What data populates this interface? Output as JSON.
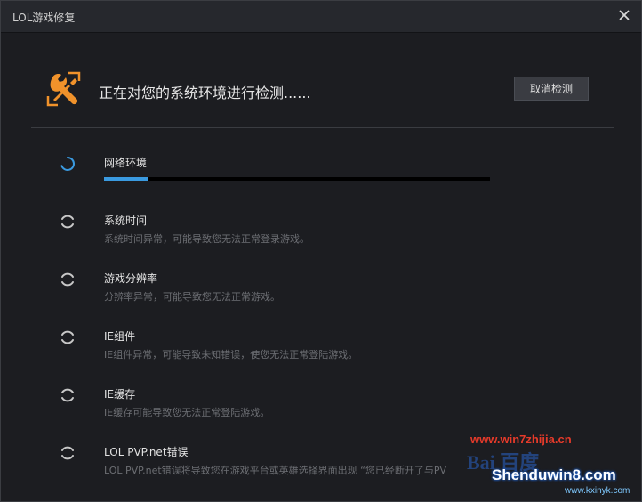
{
  "window": {
    "title": "LOL游戏修复",
    "close_icon": "close-icon"
  },
  "header": {
    "status_text": "正在对您的系统环境进行检测......",
    "cancel_label": "取消检测",
    "icon": "wrench-screwdriver-icon",
    "accent_color": "#f0922b"
  },
  "checks": [
    {
      "name": "网络环境",
      "description": "",
      "active": true,
      "progress": 0.115
    },
    {
      "name": "系统时间",
      "description": "系统时间异常，可能导致您无法正常登录游戏。",
      "active": false
    },
    {
      "name": "游戏分辨率",
      "description": "分辨率异常，可能导致您无法正常游戏。",
      "active": false
    },
    {
      "name": "IE组件",
      "description": "IE组件异常，可能导致未知错误，使您无法正常登陆游戏。",
      "active": false
    },
    {
      "name": "IE缓存",
      "description": "IE缓存可能导致您无法正常登陆游戏。",
      "active": false
    },
    {
      "name": "LOL PVP.net错误",
      "description": "LOL PVP.net错误将导致您在游戏平台或英雄选择界面出现 “您已经断开了与PV",
      "active": false
    }
  ],
  "colors": {
    "progress": "#3a9ae0",
    "spinner_active": "#3a9ae0",
    "spinner_idle": "#c8c8c8"
  },
  "watermark": {
    "url1": "www.win7zhijia.cn",
    "mark": "Bai 百度",
    "site": "Shenduwin8.com",
    "url2": "www.kxinyk.com"
  }
}
